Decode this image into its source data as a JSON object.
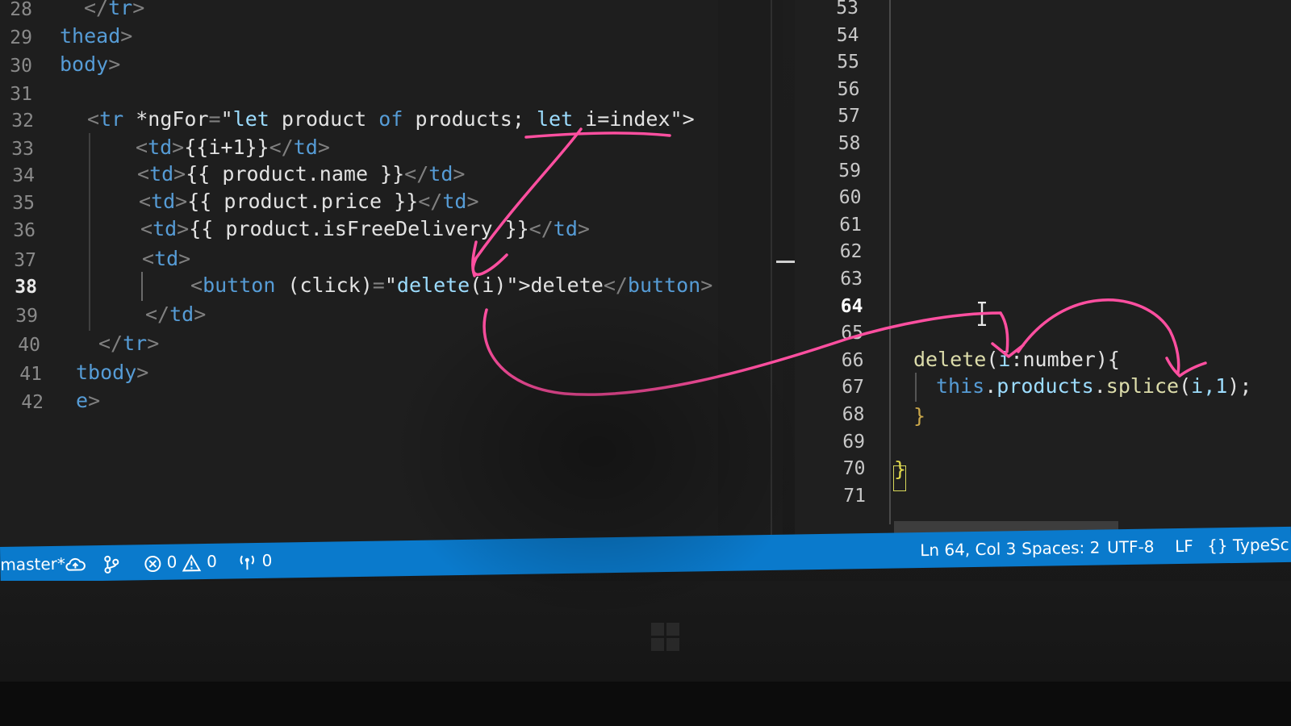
{
  "left_editor": {
    "lines": [
      {
        "num": "28",
        "parts": [
          {
            "cls": "punct",
            "t": "</"
          },
          {
            "cls": "tag",
            "t": "tr"
          },
          {
            "cls": "punct",
            "t": ">"
          }
        ]
      },
      {
        "num": "29",
        "parts": [
          {
            "cls": "tag",
            "t": "thead"
          },
          {
            "cls": "punct",
            "t": ">"
          }
        ]
      },
      {
        "num": "30",
        "parts": [
          {
            "cls": "tag",
            "t": "body"
          },
          {
            "cls": "punct",
            "t": ">"
          }
        ]
      },
      {
        "num": "31",
        "parts": []
      },
      {
        "num": "32",
        "parts": [
          {
            "cls": "punct",
            "t": "<"
          },
          {
            "cls": "tag",
            "t": "tr"
          },
          {
            "cls": "plain",
            "t": " *ngFor"
          },
          {
            "cls": "punct",
            "t": "="
          },
          {
            "cls": "plain",
            "t": "\""
          },
          {
            "cls": "attr",
            "t": "let"
          },
          {
            "cls": "plain",
            "t": " product "
          },
          {
            "cls": "kw",
            "t": "of"
          },
          {
            "cls": "plain",
            "t": " products; "
          },
          {
            "cls": "attr",
            "t": "let"
          },
          {
            "cls": "plain",
            "t": " i=index\">"
          }
        ]
      },
      {
        "num": "33",
        "parts": [
          {
            "cls": "punct",
            "t": "<"
          },
          {
            "cls": "tag",
            "t": "td"
          },
          {
            "cls": "punct",
            "t": ">"
          },
          {
            "cls": "plain",
            "t": "{{i+1}}"
          },
          {
            "cls": "punct",
            "t": "</"
          },
          {
            "cls": "tag",
            "t": "td"
          },
          {
            "cls": "punct",
            "t": ">"
          }
        ]
      },
      {
        "num": "34",
        "parts": [
          {
            "cls": "punct",
            "t": "<"
          },
          {
            "cls": "tag",
            "t": "td"
          },
          {
            "cls": "punct",
            "t": ">"
          },
          {
            "cls": "plain",
            "t": "{{ product.name }}"
          },
          {
            "cls": "punct",
            "t": "</"
          },
          {
            "cls": "tag",
            "t": "td"
          },
          {
            "cls": "punct",
            "t": ">"
          }
        ]
      },
      {
        "num": "35",
        "parts": [
          {
            "cls": "punct",
            "t": "<"
          },
          {
            "cls": "tag",
            "t": "td"
          },
          {
            "cls": "punct",
            "t": ">"
          },
          {
            "cls": "plain",
            "t": "{{ product.price }}"
          },
          {
            "cls": "punct",
            "t": "</"
          },
          {
            "cls": "tag",
            "t": "td"
          },
          {
            "cls": "punct",
            "t": ">"
          }
        ]
      },
      {
        "num": "36",
        "parts": [
          {
            "cls": "punct",
            "t": "<"
          },
          {
            "cls": "tag",
            "t": "td"
          },
          {
            "cls": "punct",
            "t": ">"
          },
          {
            "cls": "plain",
            "t": "{{ product.isFreeDelivery }}"
          },
          {
            "cls": "punct",
            "t": "</"
          },
          {
            "cls": "tag",
            "t": "td"
          },
          {
            "cls": "punct",
            "t": ">"
          }
        ]
      },
      {
        "num": "37",
        "parts": [
          {
            "cls": "punct",
            "t": "<"
          },
          {
            "cls": "tag",
            "t": "td"
          },
          {
            "cls": "punct",
            "t": ">"
          }
        ]
      },
      {
        "num": "38",
        "parts": [
          {
            "cls": "punct",
            "t": "<"
          },
          {
            "cls": "tag",
            "t": "button"
          },
          {
            "cls": "plain",
            "t": " (click)"
          },
          {
            "cls": "punct",
            "t": "="
          },
          {
            "cls": "plain",
            "t": "\""
          },
          {
            "cls": "attr",
            "t": "delete"
          },
          {
            "cls": "plain",
            "t": "(i)\">delete"
          },
          {
            "cls": "punct",
            "t": "</"
          },
          {
            "cls": "tag",
            "t": "button"
          },
          {
            "cls": "punct",
            "t": ">"
          }
        ]
      },
      {
        "num": "39",
        "parts": [
          {
            "cls": "punct",
            "t": "</"
          },
          {
            "cls": "tag",
            "t": "td"
          },
          {
            "cls": "punct",
            "t": ">"
          }
        ]
      },
      {
        "num": "40",
        "parts": [
          {
            "cls": "punct",
            "t": "</"
          },
          {
            "cls": "tag",
            "t": "tr"
          },
          {
            "cls": "punct",
            "t": ">"
          }
        ]
      },
      {
        "num": "41",
        "parts": [
          {
            "cls": "tag",
            "t": "tbody"
          },
          {
            "cls": "punct",
            "t": ">"
          }
        ]
      },
      {
        "num": "42",
        "parts": [
          {
            "cls": "tag",
            "t": "e"
          },
          {
            "cls": "punct",
            "t": ">"
          }
        ]
      }
    ]
  },
  "right_editor": {
    "line_numbers": [
      "53",
      "54",
      "55",
      "56",
      "57",
      "58",
      "59",
      "60",
      "61",
      "62",
      "63",
      "64",
      "65",
      "66",
      "67",
      "68",
      "69",
      "70",
      "71"
    ],
    "active_line": "64",
    "code": {
      "line66": {
        "name": "delete",
        "open": "(",
        "param": "i",
        "sep": ":",
        "type": "number",
        "close": "){"
      },
      "line67": {
        "obj": "this",
        "dot1": ".",
        "prop": "products",
        "dot2": ".",
        "method": "splice",
        "open": "(",
        "args": "i,1",
        "close": ");"
      },
      "line68": "}",
      "line70": "}"
    }
  },
  "status_bar": {
    "branch": "master*",
    "errors": "0",
    "warnings": "0",
    "ports": "0",
    "position": "Ln 64, Col 3",
    "spaces": "Spaces: 2",
    "encoding": "UTF-8",
    "eol": "LF",
    "language": "TypeSc"
  },
  "colors": {
    "status_bar": "#0a7acc",
    "annotation": "#ff4fa0",
    "editor_bg": "#1e1e1e"
  }
}
